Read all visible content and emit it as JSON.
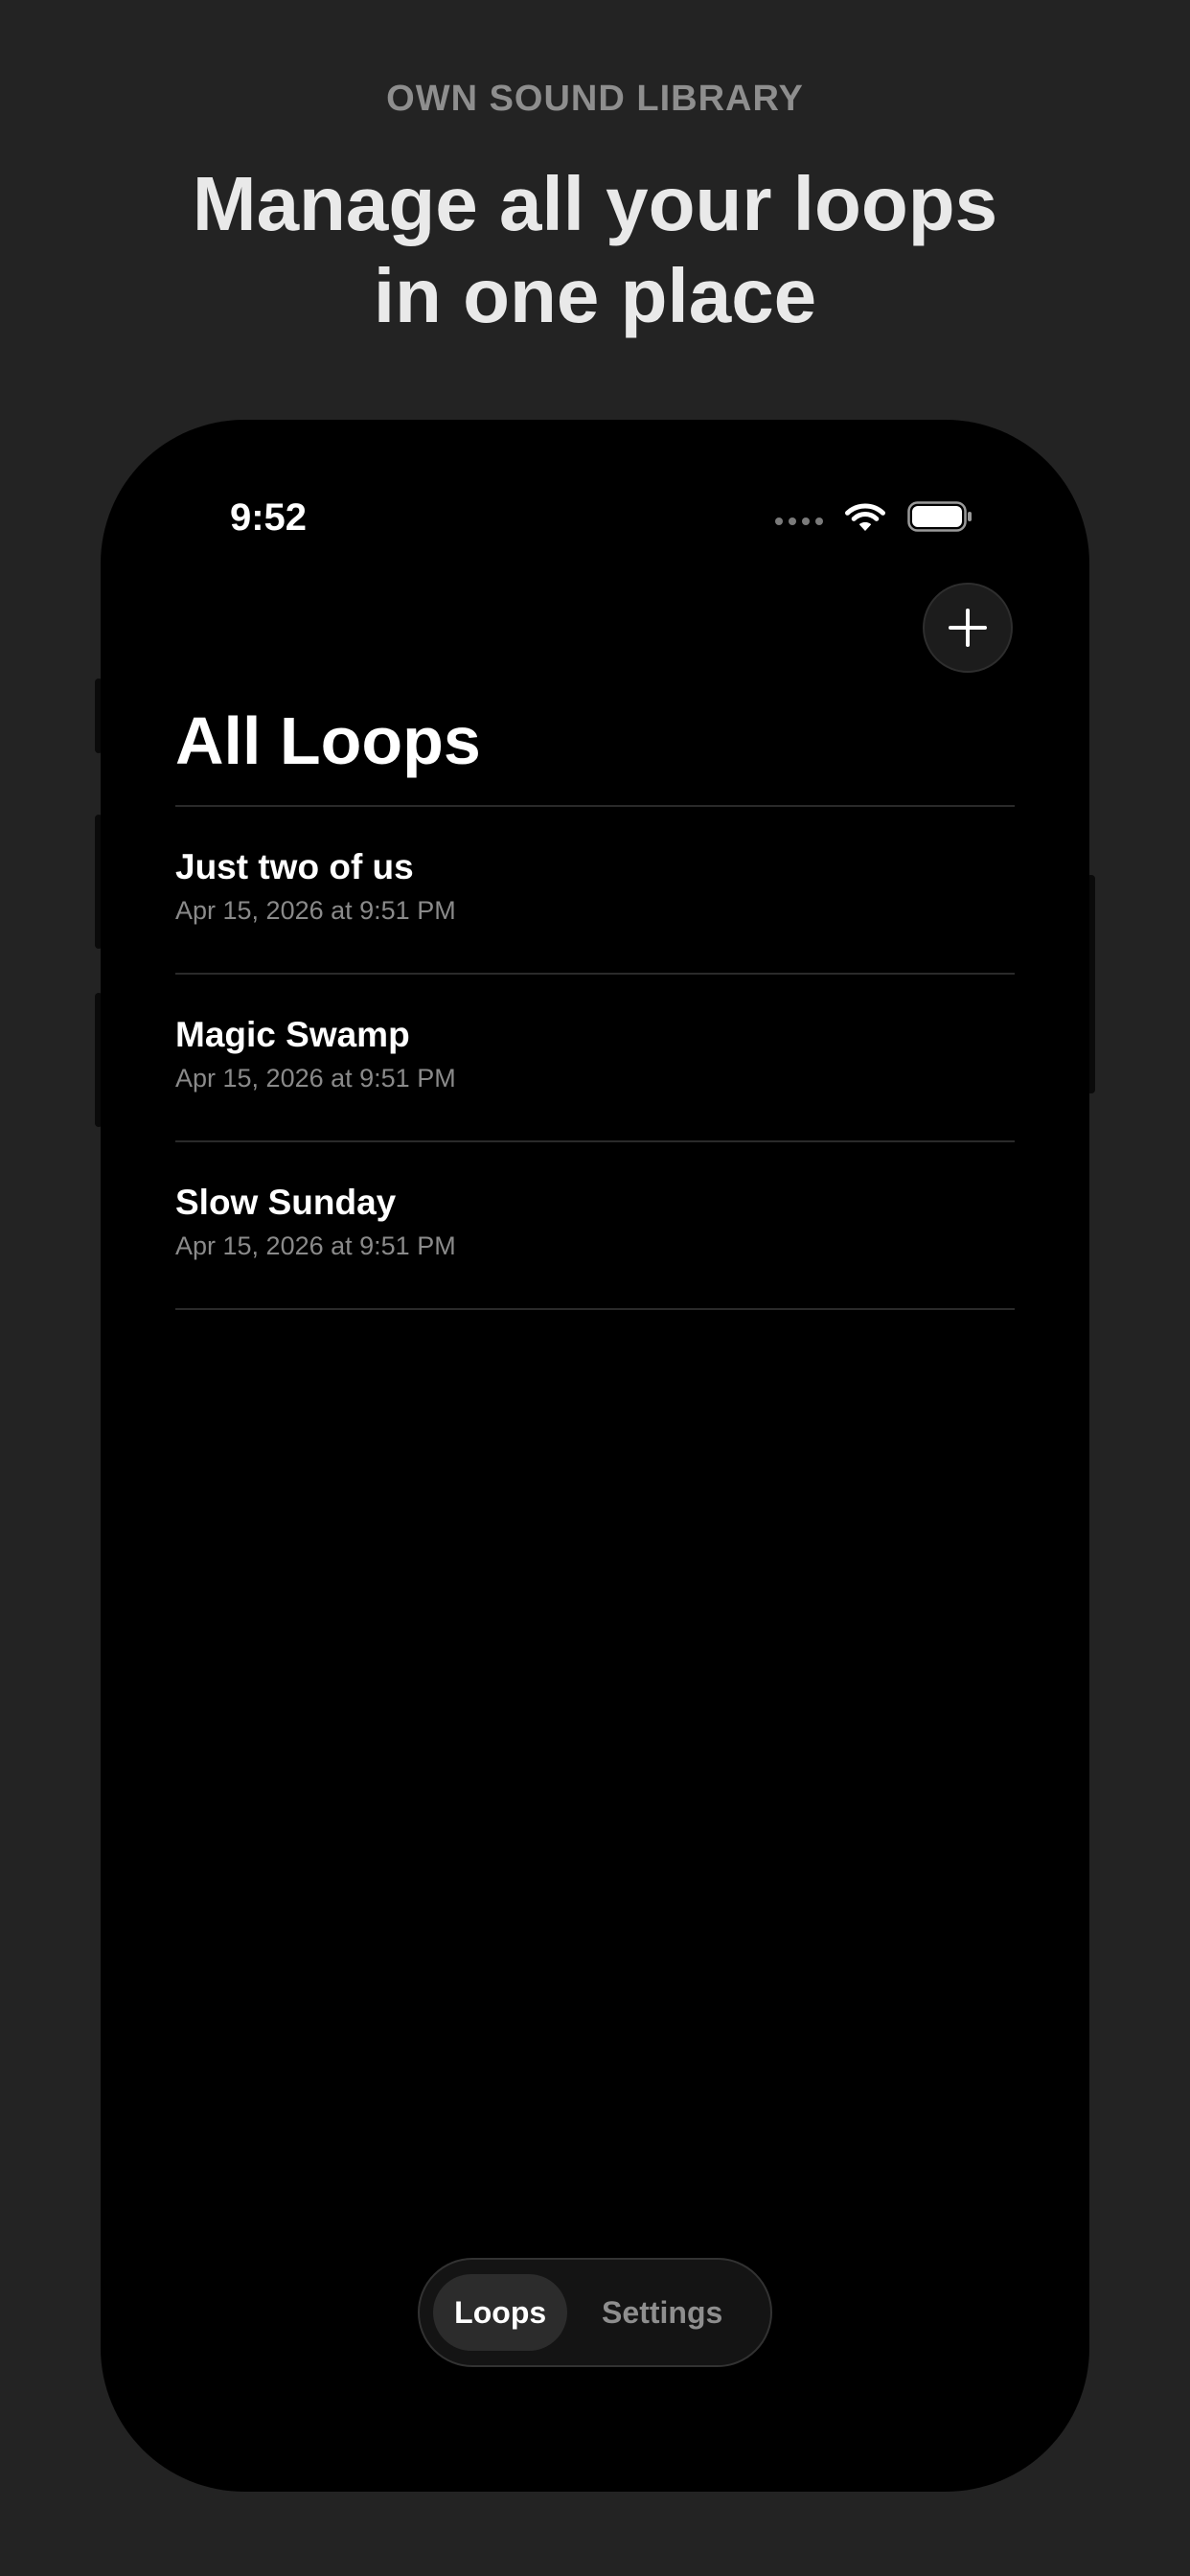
{
  "header": {
    "eyebrow": "OWN SOUND LIBRARY",
    "headline_line1": "Manage all your loops",
    "headline_line2": "in one place"
  },
  "status_bar": {
    "time": "9:52",
    "icons": [
      "signal-dots-icon",
      "wifi-icon",
      "battery-icon"
    ]
  },
  "screen": {
    "add_icon": "plus-icon",
    "title": "All Loops",
    "loops": [
      {
        "name": "Just two of us",
        "date": "Apr 15, 2026 at 9:51 PM"
      },
      {
        "name": "Magic Swamp",
        "date": "Apr 15, 2026 at 9:51 PM"
      },
      {
        "name": "Slow Sunday",
        "date": "Apr 15, 2026 at 9:51 PM"
      }
    ]
  },
  "tabbar": {
    "tabs": [
      {
        "label": "Loops",
        "active": true
      },
      {
        "label": "Settings",
        "active": false
      }
    ]
  },
  "colors": {
    "background": "#232323",
    "screen": "#000000",
    "text_primary": "#ffffff",
    "text_secondary": "#8a8a8a",
    "divider": "#2a2a2a"
  }
}
